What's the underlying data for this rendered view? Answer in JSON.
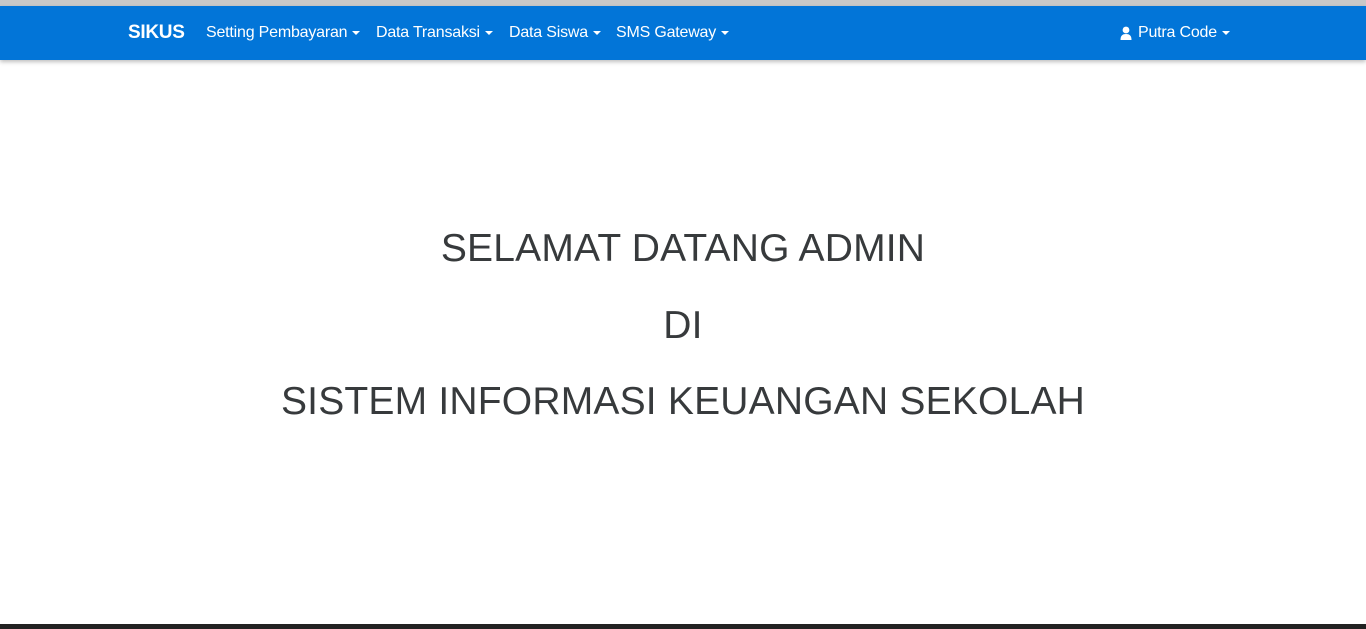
{
  "navbar": {
    "brand": "SIKUS",
    "menu": [
      {
        "label": "Setting Pembayaran"
      },
      {
        "label": "Data Transaksi"
      },
      {
        "label": "Data Siswa"
      },
      {
        "label": "SMS Gateway"
      }
    ],
    "user": {
      "label": "Putra Code",
      "icon": "user-icon"
    }
  },
  "main": {
    "line1": "SELAMAT DATANG ADMIN",
    "line2": "DI",
    "line3": "SISTEM INFORMASI KEUANGAN SEKOLAH"
  },
  "colors": {
    "navbar": "#0275d8",
    "text": "#373a3c"
  }
}
